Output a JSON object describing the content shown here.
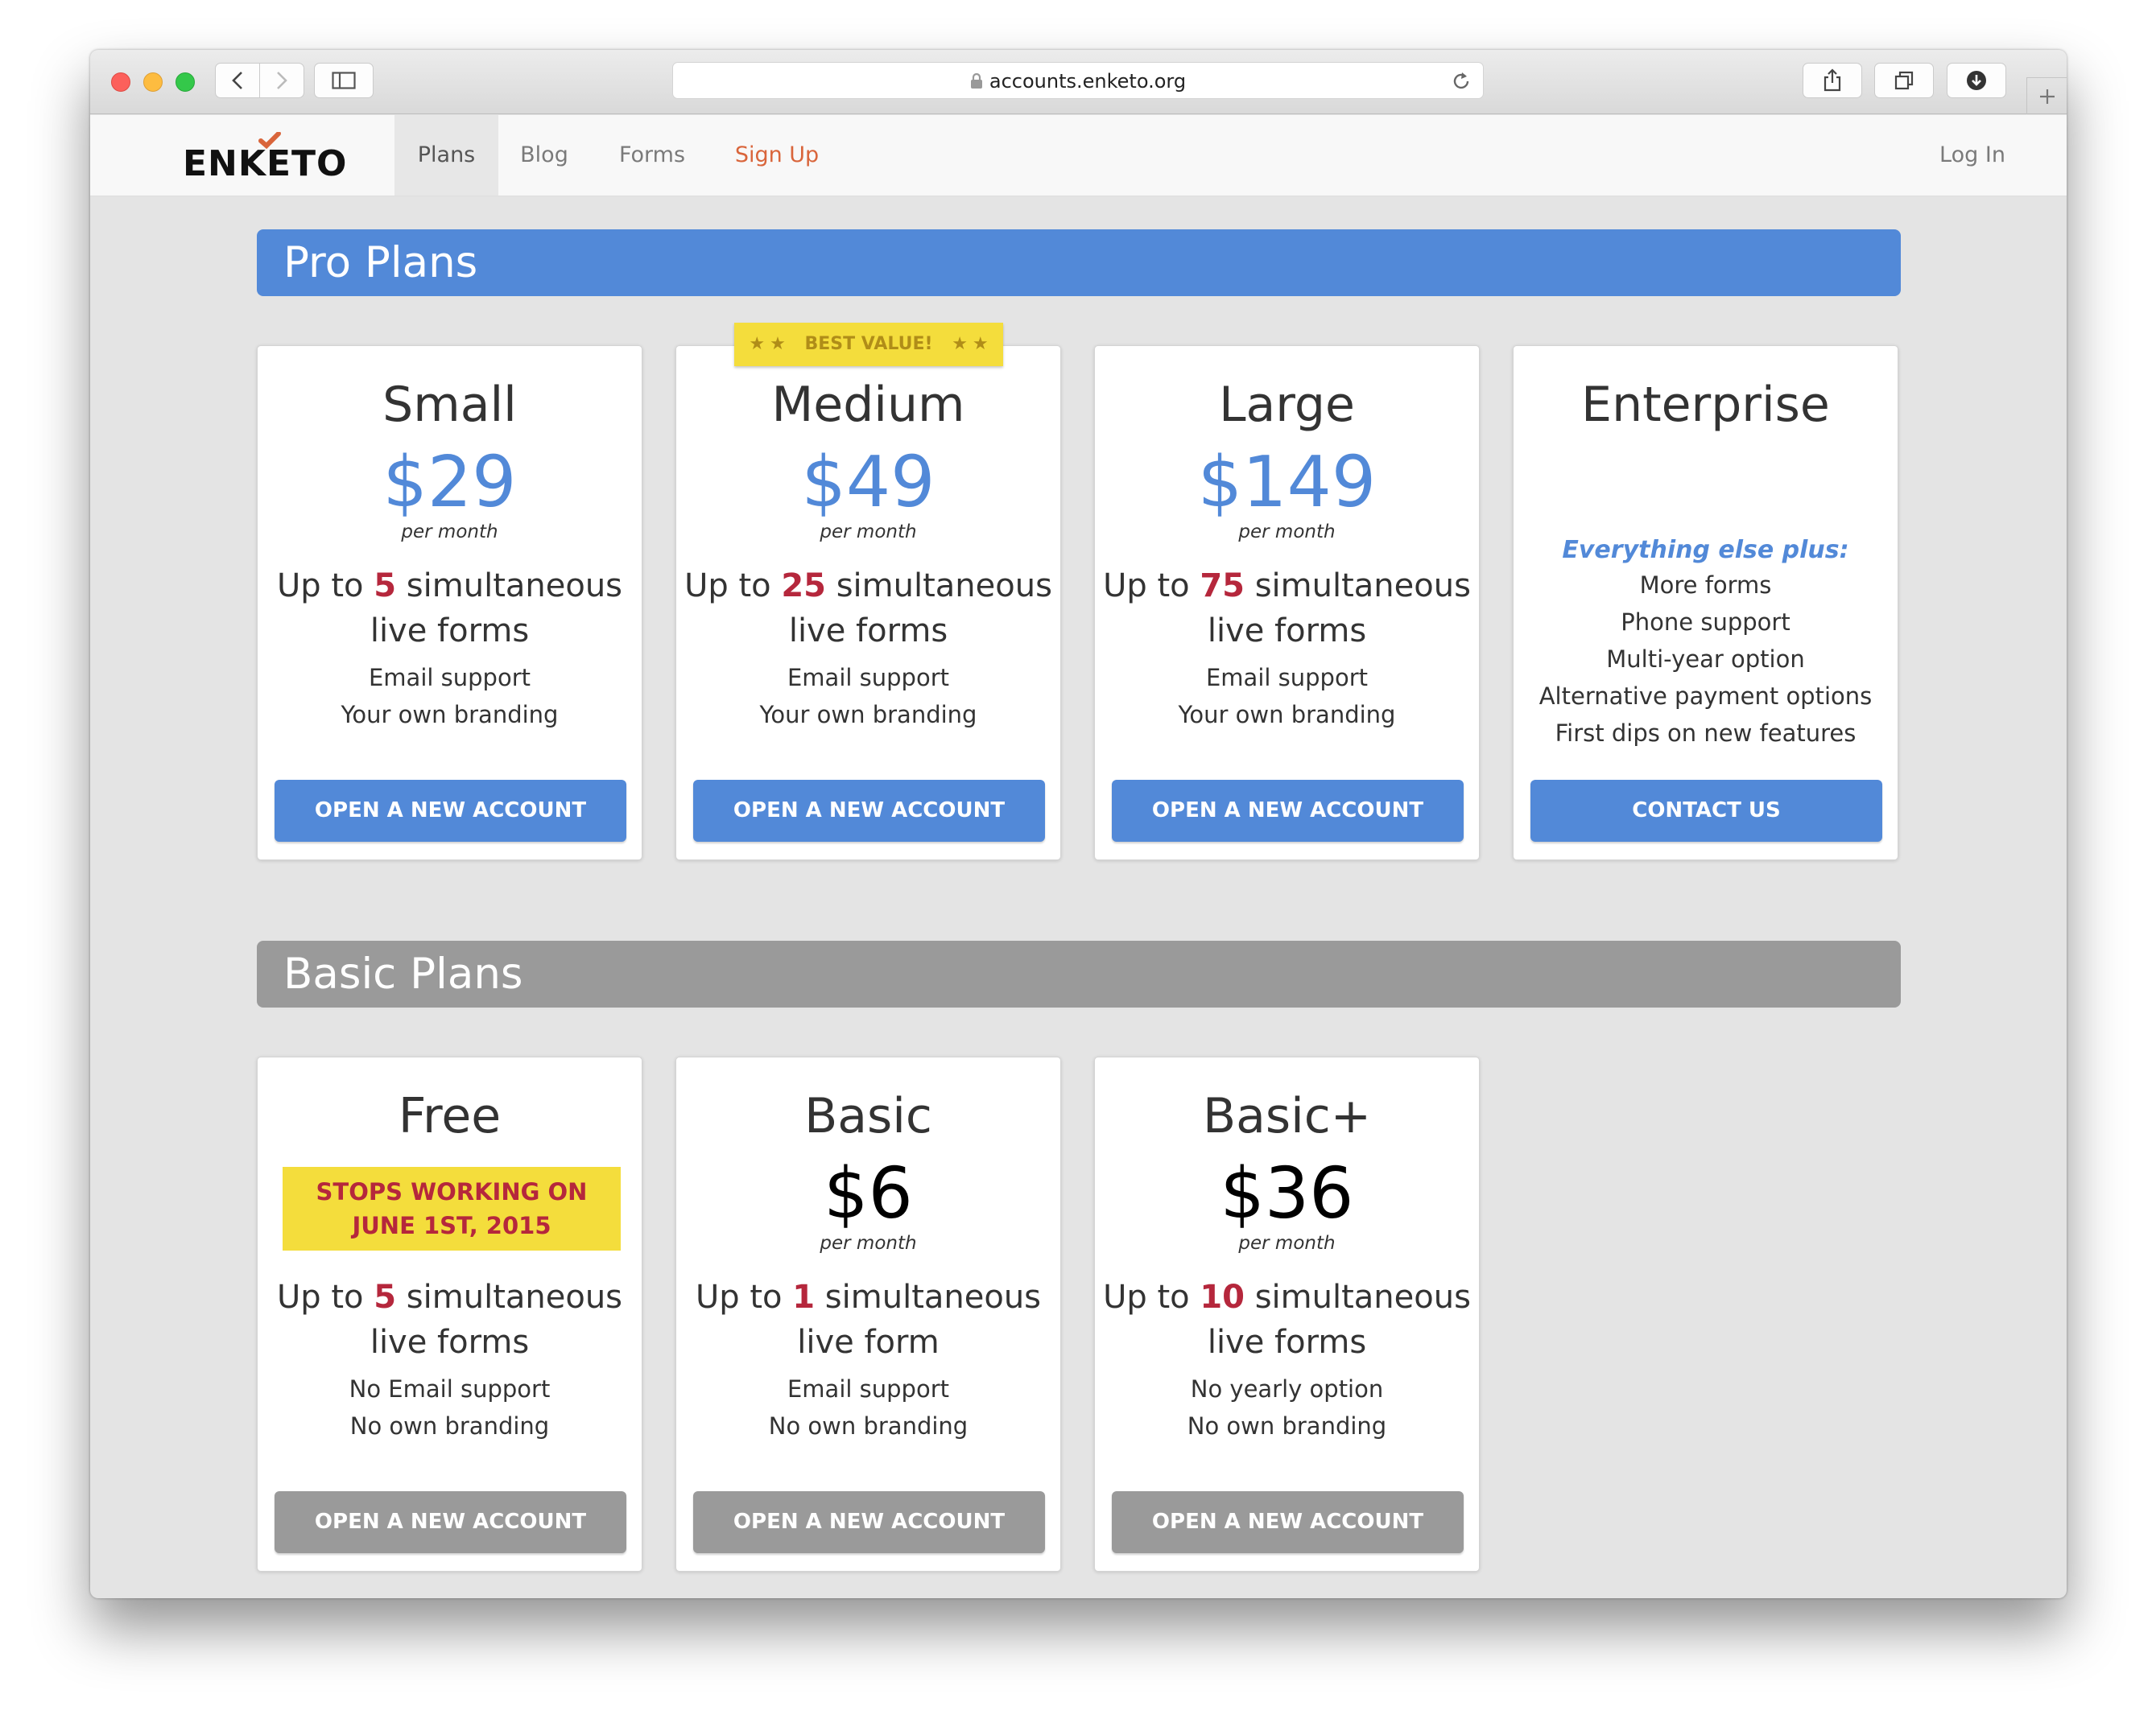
{
  "browser": {
    "url": "accounts.enketo.org"
  },
  "nav": {
    "logo": "ENKETO",
    "items": [
      {
        "label": "Plans"
      },
      {
        "label": "Blog"
      },
      {
        "label": "Forms"
      },
      {
        "label": "Sign Up"
      }
    ],
    "login": "Log In",
    "active_item": "Plans",
    "signup_color": "#d9653b"
  },
  "pro": {
    "title": "Pro Plans",
    "color": "#5289d8",
    "ribbon": "BEST VALUE!",
    "cards": [
      {
        "name": "Small",
        "price": "$29",
        "per": "per month",
        "pre": "Up to ",
        "num": "5",
        "post": " simultaneous",
        "line2": "live forms",
        "features": [
          "Email support",
          "Your own branding"
        ],
        "button": "OPEN A NEW ACCOUNT"
      },
      {
        "name": "Medium",
        "price": "$49",
        "per": "per month",
        "pre": "Up to ",
        "num": "25",
        "post": " simultaneous",
        "line2": "live forms",
        "features": [
          "Email support",
          "Your own branding"
        ],
        "button": "OPEN A NEW ACCOUNT"
      },
      {
        "name": "Large",
        "price": "$149",
        "per": "per month",
        "pre": "Up to ",
        "num": "75",
        "post": " simultaneous",
        "line2": "live forms",
        "features": [
          "Email support",
          "Your own branding"
        ],
        "button": "OPEN A NEW ACCOUNT"
      },
      {
        "name": "Enterprise",
        "subtitle": "Everything else plus:",
        "features": [
          "More forms",
          "Phone support",
          "Multi-year option",
          "Alternative payment options",
          "First dips on new features"
        ],
        "button": "CONTACT US"
      }
    ]
  },
  "basic": {
    "title": "Basic Plans",
    "color": "#9a9a9a",
    "cards": [
      {
        "name": "Free",
        "notice": "STOPS WORKING ON JUNE 1ST, 2015",
        "pre": "Up to ",
        "num": "5",
        "post": " simultaneous",
        "line2": "live forms",
        "features": [
          "No Email support",
          "No own branding"
        ],
        "button": "OPEN A NEW ACCOUNT"
      },
      {
        "name": "Basic",
        "price": "$6",
        "per": "per month",
        "pre": "Up to ",
        "num": "1",
        "post": " simultaneous",
        "line2": "live form",
        "features": [
          "Email support",
          "No own branding"
        ],
        "button": "OPEN A NEW ACCOUNT"
      },
      {
        "name": "Basic+",
        "price": "$36",
        "per": "per month",
        "pre": "Up to ",
        "num": "10",
        "post": " simultaneous",
        "line2": "live forms",
        "features": [
          "No yearly option",
          "No own branding"
        ],
        "button": "OPEN A NEW ACCOUNT"
      }
    ]
  },
  "colors": {
    "pro_price": "#5289d8",
    "basic_price": "#000000",
    "highlight_number": "#b5273c",
    "ribbon_bg": "#f4dd3c",
    "ribbon_text": "#b08d18",
    "notice_text": "#b5273c"
  }
}
